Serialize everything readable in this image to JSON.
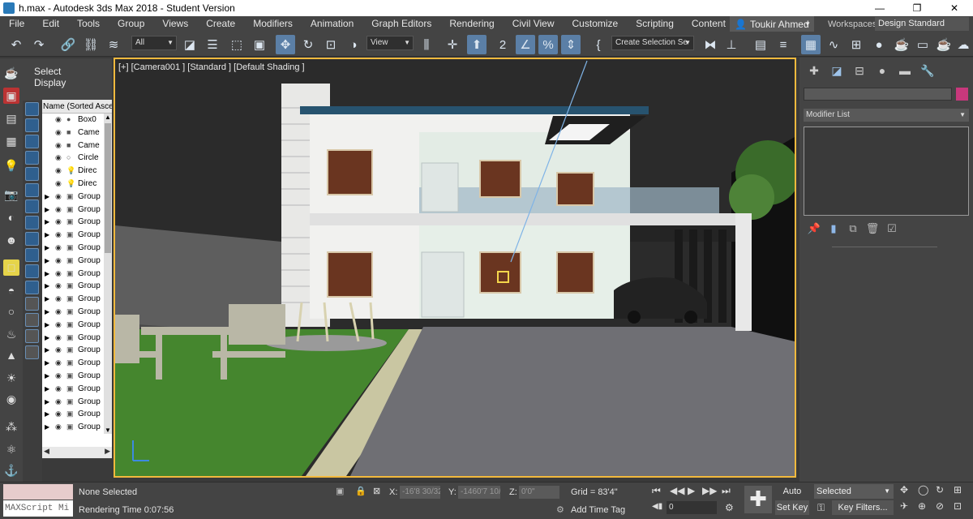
{
  "window": {
    "title": "h.max - Autodesk 3ds Max 2018 - Student Version",
    "minimize": "—",
    "restore": "❐",
    "close": "✕"
  },
  "menu": [
    "File",
    "Edit",
    "Tools",
    "Group",
    "Views",
    "Create",
    "Modifiers",
    "Animation",
    "Graph Editors",
    "Rendering",
    "Civil View",
    "Customize",
    "Scripting",
    "Content"
  ],
  "user": {
    "name": "Toukir Ahmed"
  },
  "workspaces": {
    "label": "Workspaces:",
    "value": "Design Standard"
  },
  "toolbar": {
    "filter": "All",
    "refcoord": "View",
    "selection_set": "Create Selection Se",
    "snap_label": "2"
  },
  "scene_explorer": {
    "tab_select": "Select",
    "tab_display": "Display",
    "header": "Name (Sorted Asce",
    "rows": [
      {
        "name": "Box0",
        "type": "box"
      },
      {
        "name": "Came",
        "type": "camera"
      },
      {
        "name": "Came",
        "type": "camera"
      },
      {
        "name": "Circle",
        "type": "shape"
      },
      {
        "name": "Direc",
        "type": "light"
      },
      {
        "name": "Direc",
        "type": "light"
      },
      {
        "name": "Group",
        "type": "group"
      },
      {
        "name": "Group",
        "type": "group"
      },
      {
        "name": "Group",
        "type": "group"
      },
      {
        "name": "Group",
        "type": "group"
      },
      {
        "name": "Group",
        "type": "group"
      },
      {
        "name": "Group",
        "type": "group"
      },
      {
        "name": "Group",
        "type": "group"
      },
      {
        "name": "Group",
        "type": "group"
      },
      {
        "name": "Group",
        "type": "group"
      },
      {
        "name": "Group",
        "type": "group"
      },
      {
        "name": "Group",
        "type": "group"
      },
      {
        "name": "Group",
        "type": "group"
      },
      {
        "name": "Group",
        "type": "group"
      },
      {
        "name": "Group",
        "type": "group"
      },
      {
        "name": "Group",
        "type": "group"
      },
      {
        "name": "Group",
        "type": "group"
      },
      {
        "name": "Group",
        "type": "group"
      },
      {
        "name": "Group",
        "type": "group"
      },
      {
        "name": "Group",
        "type": "group"
      }
    ]
  },
  "viewport": {
    "label": "[+] [Camera001 ] [Standard ] [Default Shading ]"
  },
  "command_panel": {
    "modifier_list": "Modifier List",
    "object_color": "#c8387c"
  },
  "status": {
    "selection": "None Selected",
    "render_time": "Rendering Time  0:07:56",
    "maxscript": "MAXScript Mi",
    "x_label": "X:",
    "x_value": "-16'8 30/32",
    "y_label": "Y:",
    "y_value": "-1460'7 10/",
    "z_label": "Z:",
    "z_value": "0'0\"",
    "grid": "Grid = 83'4\"",
    "add_time_tag": "Add Time Tag",
    "auto_key": "Auto Key",
    "set_key": "Set Key",
    "key_mode": "Selected",
    "key_filters": "Key Filters...",
    "frame": "0"
  },
  "colors": {
    "accent": "#5b7fa6",
    "viewport_border": "#f2b93d"
  }
}
